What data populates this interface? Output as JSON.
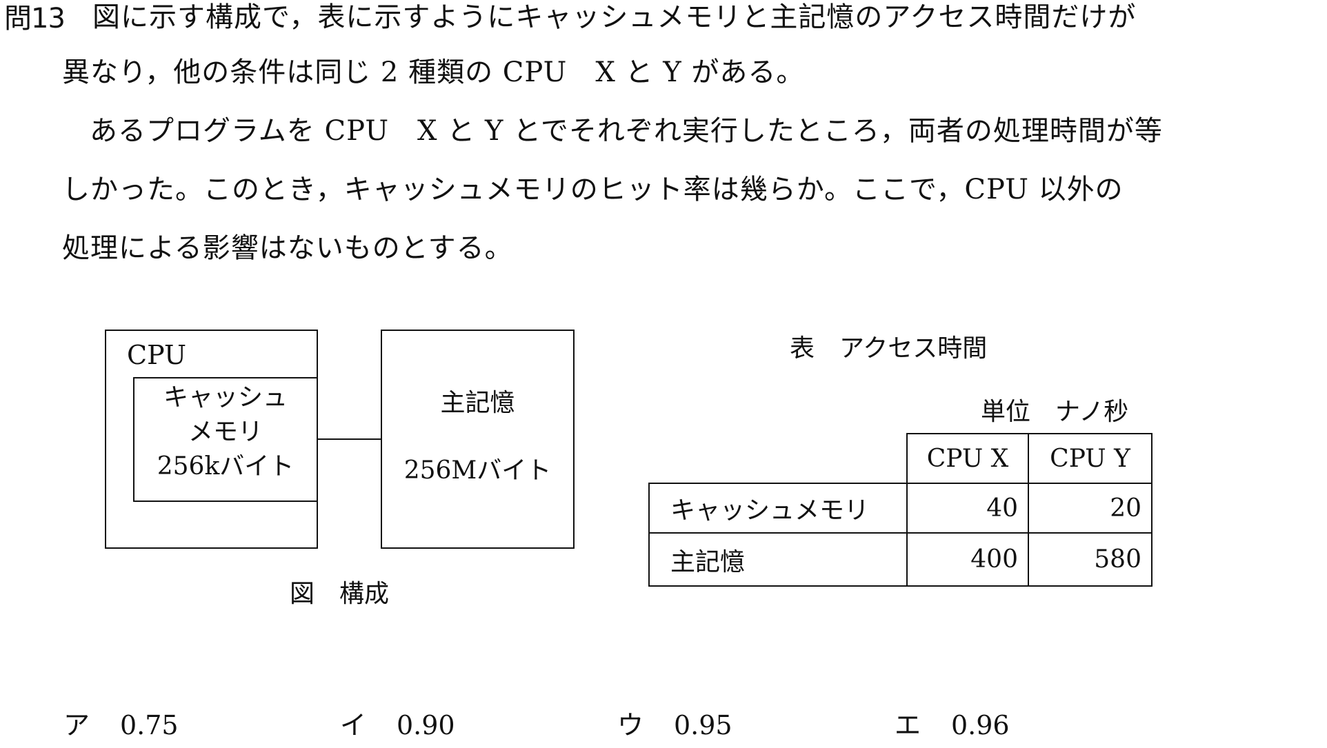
{
  "question": {
    "number": "問13",
    "lines": [
      "図に示す構成で，表に示すようにキャッシュメモリと主記憶のアクセス時間だけが",
      "異なり，他の条件は同じ 2 種類の CPU　X と Y がある。",
      "あるプログラムを CPU　X と Y とでそれぞれ実行したところ，両者の処理時間が等",
      "しかった。このとき，キャッシュメモリのヒット率は幾らか。ここで，CPU 以外の",
      "処理による影響はないものとする。"
    ]
  },
  "figure": {
    "cpu_label": "CPU",
    "cache_lines": [
      "キャッシュ",
      "メモリ",
      "256kバイト"
    ],
    "memory_title": "主記憶",
    "memory_size": "256Mバイト",
    "caption": "図　構成"
  },
  "table": {
    "caption": "表　アクセス時間",
    "unit": "単位　ナノ秒",
    "headers": [
      "CPU X",
      "CPU Y"
    ],
    "rows": [
      {
        "label": "キャッシュメモリ",
        "values": [
          "40",
          "20"
        ]
      },
      {
        "label": "主記憶",
        "values": [
          "400",
          "580"
        ]
      }
    ]
  },
  "choices": [
    {
      "mark": "ア",
      "value": "0.75"
    },
    {
      "mark": "イ",
      "value": "0.90"
    },
    {
      "mark": "ウ",
      "value": "0.95"
    },
    {
      "mark": "エ",
      "value": "0.96"
    }
  ]
}
